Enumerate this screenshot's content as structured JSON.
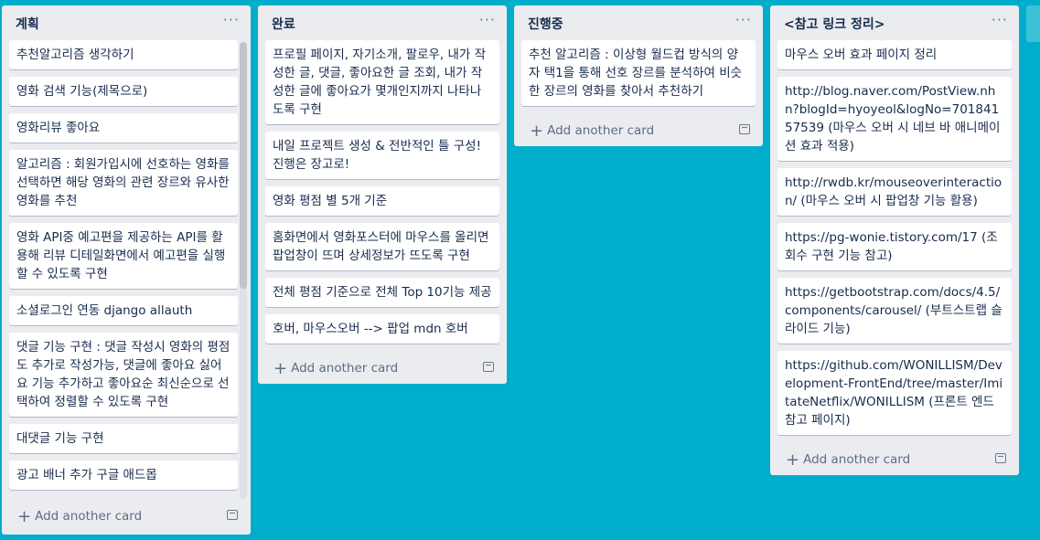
{
  "lists": [
    {
      "title": "계획",
      "cards": [
        "추천알고리즘 생각하기",
        "영화 검색 기능(제목으로)",
        "영화리뷰 좋아요",
        "알고리즘 : 회원가입시에 선호하는 영화를 선택하면 해당 영화의 관련 장르와 유사한 영화를 추천",
        "영화 API중 예고편을 제공하는 API를 활용해 리뷰 디테일화면에서 예고편을 실행할 수 있도록 구현",
        "소셜로그인 연동 django allauth",
        "댓글 기능 구현 : 댓글 작성시 영화의 평점도 추가로 작성가능, 댓글에 좋아요 싫어요 기능 추가하고 좋아요순 최신순으로 선택하여 정렬할 수 있도록 구현",
        "대댓글 기능 구현",
        "광고 배너 추가 구글 애드몹"
      ],
      "add_label": "Add another card"
    },
    {
      "title": "완료",
      "cards": [
        "프로필 페이지, 자기소개, 팔로우, 내가 작성한 글, 댓글, 좋아요한 글 조회, 내가 작성한 글에 좋아요가 몇개인지까지 나타나도록 구현",
        "내일 프로젝트 생성 & 전반적인 틀 구성! 진행은 장고로!",
        "영화 평점 별 5개 기준",
        "홈화면에서 영화포스터에 마우스를 올리면 팝업창이 뜨며 상세정보가 뜨도록 구현",
        "전체 평점 기준으로 전체 Top 10기능 제공",
        "호버, 마우스오버 --> 팝업 mdn 호버"
      ],
      "add_label": "Add another card"
    },
    {
      "title": "진행중",
      "cards": [
        "추천 알고리즘 : 이상형 월드컵 방식의 양자 택1을 통해 선호 장르를 분석하여 비슷한 장르의 영화를 찾아서 추천하기"
      ],
      "add_label": "Add another card"
    },
    {
      "title": "<참고 링크 정리>",
      "cards": [
        "마우스 오버 효과 페이지 정리",
        "http://blog.naver.com/PostView.nhn?blogId=hyoyeol&logNo=70184157539 (마우스 오버 시 네브 바 애니메이션 효과 적용)",
        "http://rwdb.kr/mouseoverinteraction/ (마우스 오버 시 팝업창 기능 활용)",
        "https://pg-wonie.tistory.com/17 (조회수 구현 기능 참고)",
        "https://getbootstrap.com/docs/4.5/components/carousel/ (부트스트랩 슬라이드 기능)",
        "https://github.com/WONILLISM/Development-FrontEnd/tree/master/ImitateNetflix/WONILLISM (프론트 엔드 참고 페이지)"
      ],
      "add_label": "Add another card"
    }
  ],
  "menu_glyph": "···",
  "plus_glyph": "+",
  "colors": {
    "board_bg": "#00aecc",
    "list_bg": "#ebecf0"
  }
}
